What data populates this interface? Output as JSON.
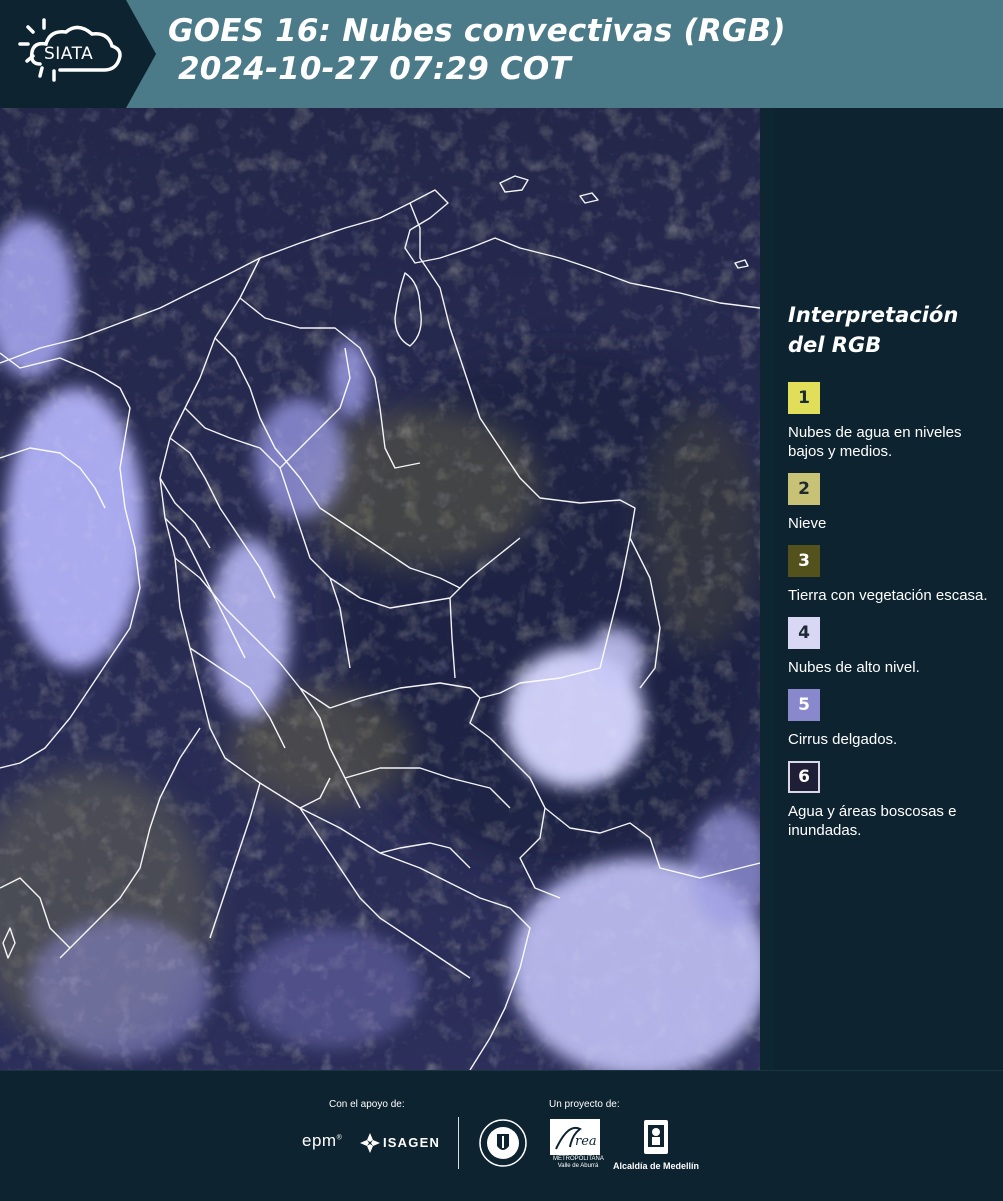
{
  "header": {
    "logo_text": "SIATA",
    "title_line1": "GOES 16: Nubes convectivas (RGB)",
    "title_line2": "2024-10-27 07:29 COT"
  },
  "legend": {
    "title": "Interpretación del RGB",
    "items": [
      {
        "num": "1",
        "label": "Nubes de agua en niveles bajos y medios.",
        "color": "#e1de5a"
      },
      {
        "num": "2",
        "label": "Nieve",
        "color": "#c7c275"
      },
      {
        "num": "3",
        "label": "Tierra con vegetación escasa.",
        "color": "#54521c"
      },
      {
        "num": "4",
        "label": "Nubes de alto nivel.",
        "color": "#d8d8f4"
      },
      {
        "num": "5",
        "label": "Cirrus delgados.",
        "color": "#8a88cc"
      },
      {
        "num": "6",
        "label": "Agua y áreas boscosas e inundadas.",
        "color": "#1e1e36"
      }
    ]
  },
  "footer": {
    "support_label": "Con el apoyo de:",
    "project_label": "Un proyecto de:",
    "sponsor_epm": "epm",
    "sponsor_isagen": "ISAGEN",
    "metro_text": "METROPOLITANA Valle de Aburrá",
    "alcaldia": "Alcaldía de Medellín"
  },
  "colors": {
    "header_bg": "#4b7a89",
    "page_bg": "#0d2330",
    "map_base": "#272a50",
    "boundary": "#ffffff"
  }
}
